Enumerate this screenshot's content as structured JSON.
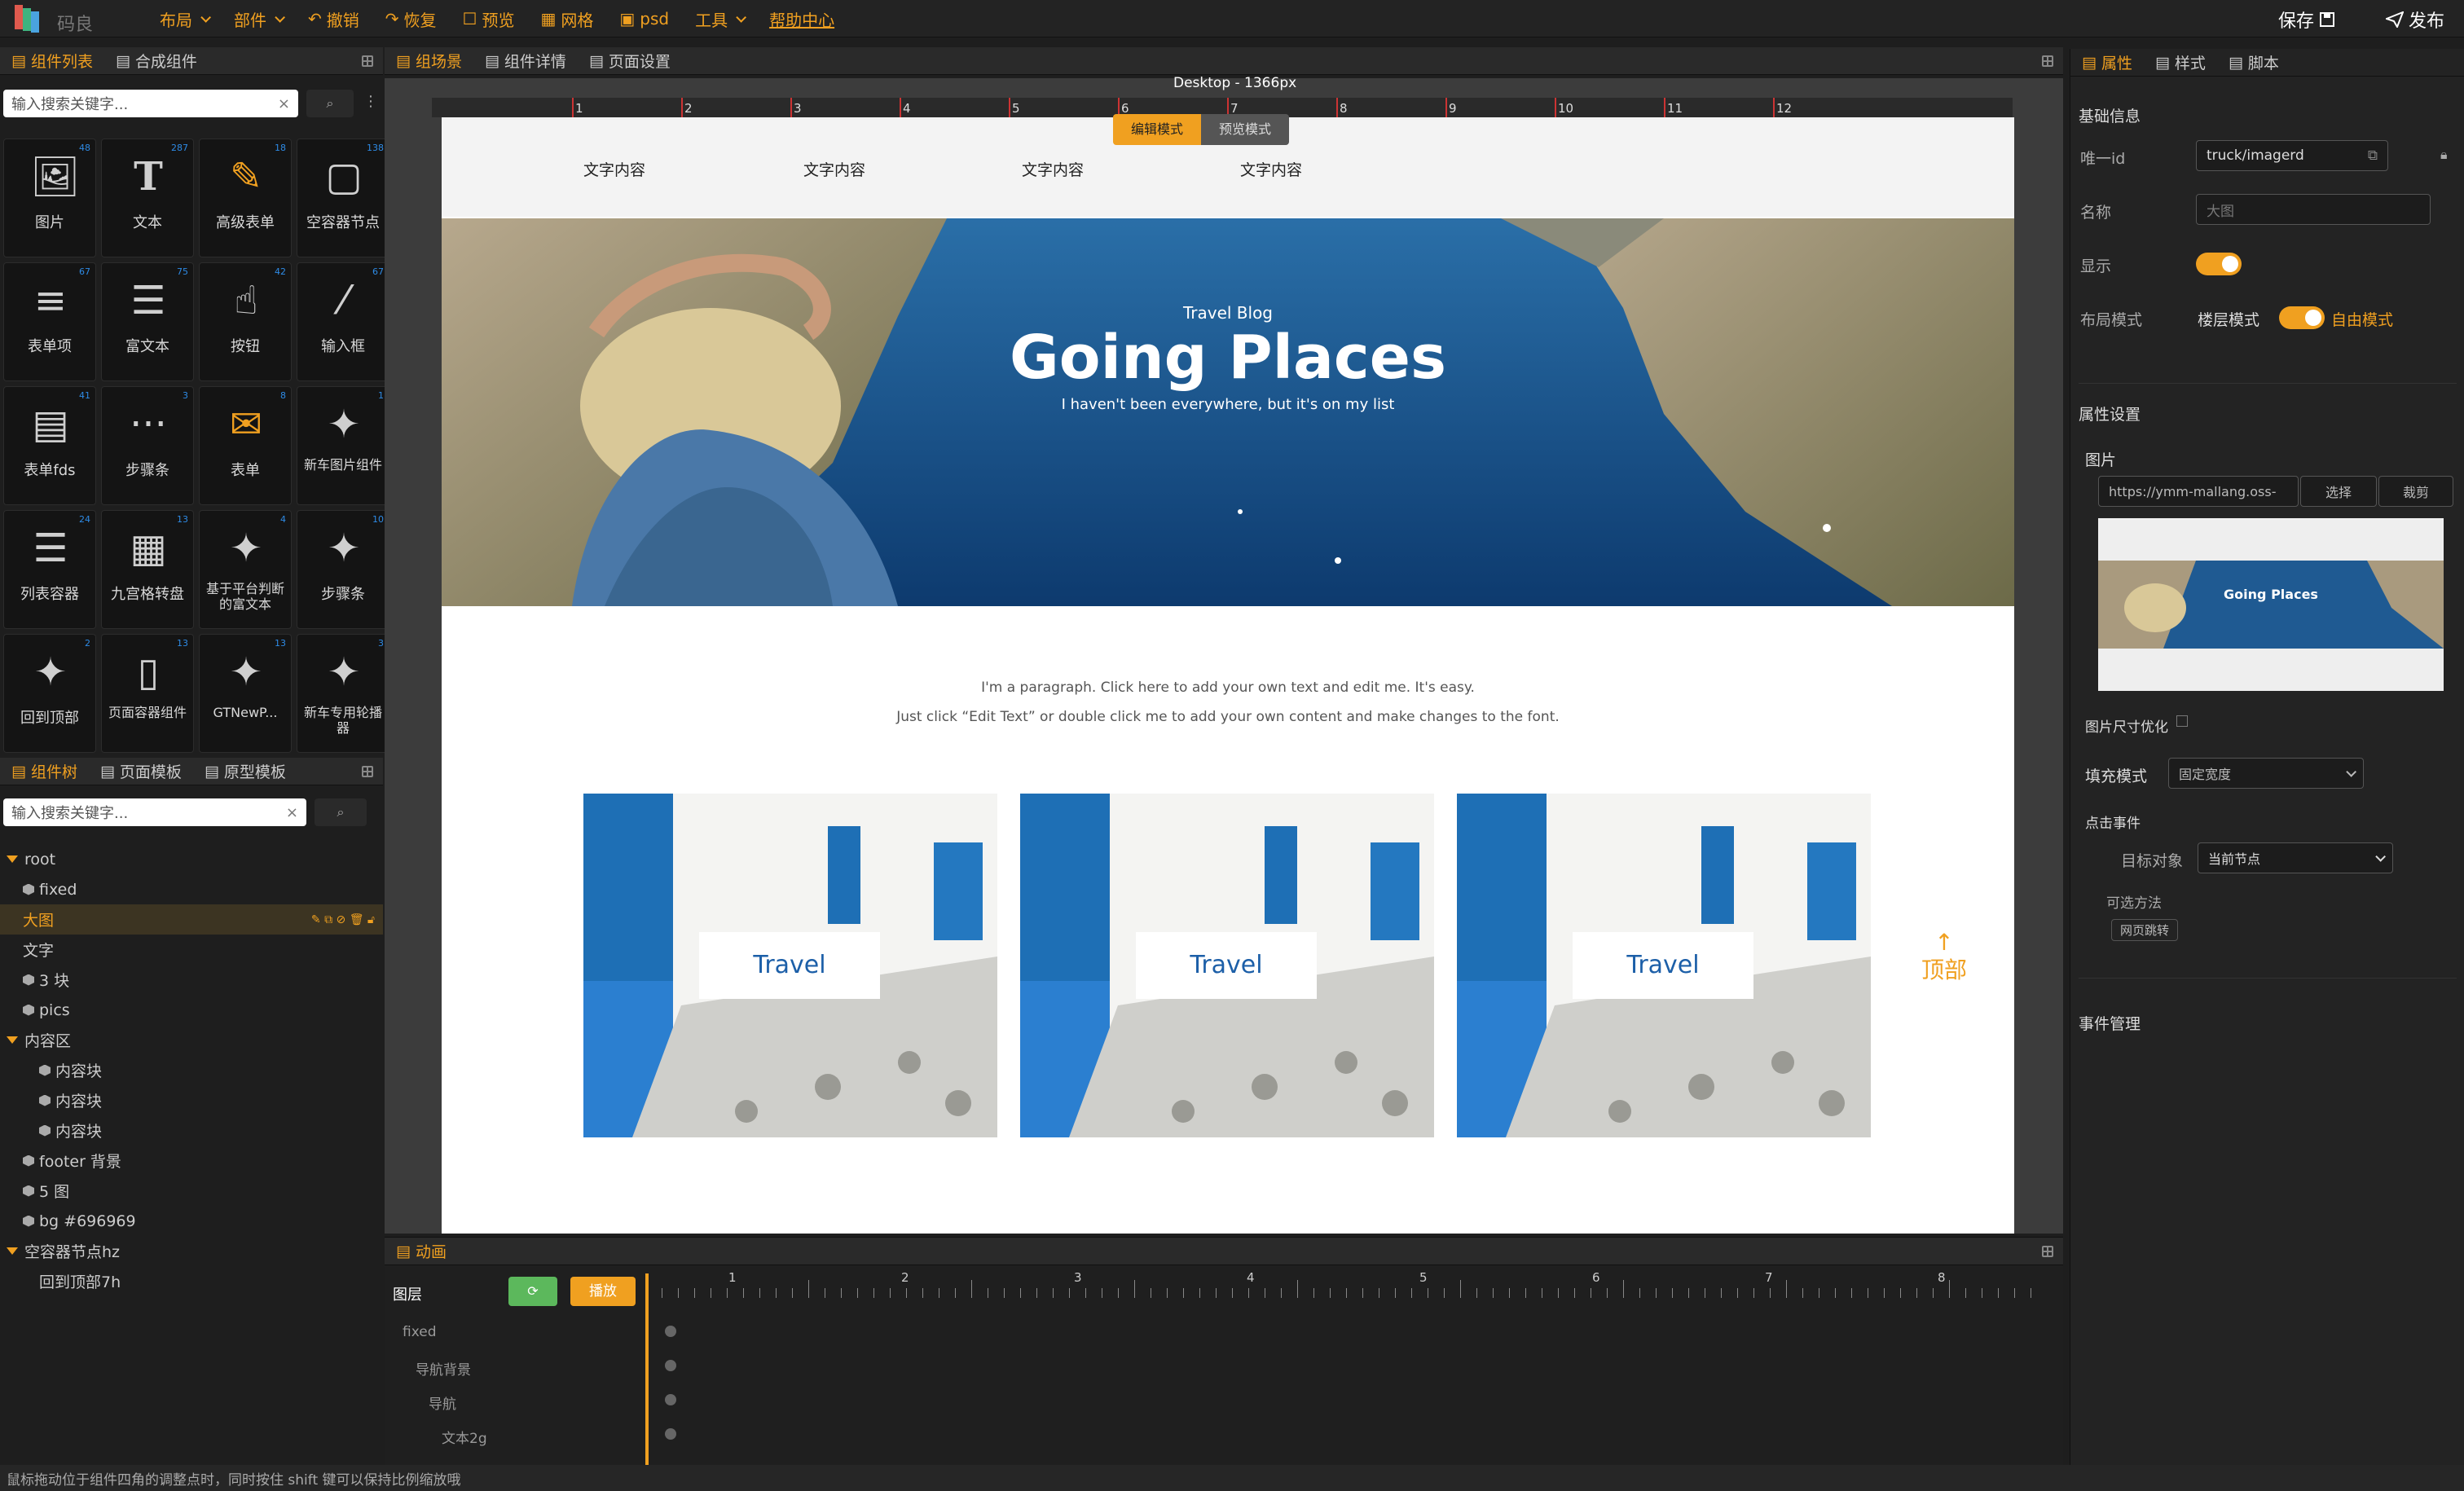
{
  "app": {
    "brand": "码良"
  },
  "menu": [
    {
      "label": "布局",
      "dropdown": true
    },
    {
      "label": "部件",
      "dropdown": true
    },
    {
      "label": "撤销",
      "dropdown": false
    },
    {
      "label": "恢复",
      "dropdown": false
    },
    {
      "label": "预览",
      "dropdown": false
    },
    {
      "label": "网格",
      "dropdown": false
    },
    {
      "label": "psd",
      "dropdown": false
    },
    {
      "label": "工具",
      "dropdown": true
    },
    {
      "label": "帮助中心",
      "dropdown": false
    }
  ],
  "actions": {
    "save": "保存",
    "publish": "发布"
  },
  "leftTop": {
    "tabs": [
      "组件列表",
      "合成组件"
    ],
    "searchPlaceholder": "输入搜索关键字...",
    "components": [
      {
        "label": "图片",
        "badge": "48",
        "icon": "image-icon"
      },
      {
        "label": "文本",
        "badge": "287",
        "icon": "text-icon"
      },
      {
        "label": "高级表单",
        "badge": "18",
        "icon": "advanced-form-icon"
      },
      {
        "label": "空容器节点",
        "badge": "138",
        "icon": "empty-container-icon"
      },
      {
        "label": "表单项",
        "badge": "67",
        "icon": "form-item-icon"
      },
      {
        "label": "富文本",
        "badge": "75",
        "icon": "rich-text-icon"
      },
      {
        "label": "按钮",
        "badge": "42",
        "icon": "button-icon"
      },
      {
        "label": "输入框",
        "badge": "67",
        "icon": "input-icon"
      },
      {
        "label": "表单fds",
        "badge": "41",
        "icon": "form-fds-icon"
      },
      {
        "label": "步骤条",
        "badge": "3",
        "icon": "steps-icon"
      },
      {
        "label": "表单",
        "badge": "8",
        "icon": "form-icon"
      },
      {
        "label": "新车图片组件",
        "badge": "1",
        "icon": "puzzle-icon"
      },
      {
        "label": "列表容器",
        "badge": "24",
        "icon": "list-container-icon"
      },
      {
        "label": "九宫格转盘",
        "badge": "13",
        "icon": "grid-wheel-icon"
      },
      {
        "label": "基于平台判断的富文本",
        "badge": "4",
        "icon": "puzzle-icon"
      },
      {
        "label": "步骤条",
        "badge": "10",
        "icon": "puzzle-icon"
      },
      {
        "label": "回到顶部",
        "badge": "2",
        "icon": "puzzle-icon"
      },
      {
        "label": "页面容器组件",
        "badge": "13",
        "icon": "page-container-icon"
      },
      {
        "label": "GTNewP...",
        "badge": "13",
        "icon": "puzzle-icon"
      },
      {
        "label": "新车专用轮播器",
        "badge": "3",
        "icon": "puzzle-icon"
      }
    ]
  },
  "leftBottom": {
    "tabs": [
      "组件树",
      "页面模板",
      "原型模板"
    ],
    "searchPlaceholder": "输入搜索关键字...",
    "tree": [
      {
        "label": "root",
        "indent": 0,
        "type": "folder-open"
      },
      {
        "label": "fixed",
        "indent": 1,
        "type": "node"
      },
      {
        "label": "大图",
        "indent": 1,
        "type": "selected"
      },
      {
        "label": "文字",
        "indent": 1,
        "type": "plain"
      },
      {
        "label": "3 块",
        "indent": 1,
        "type": "node"
      },
      {
        "label": "pics",
        "indent": 1,
        "type": "node"
      },
      {
        "label": "内容区",
        "indent": 0,
        "type": "folder-open"
      },
      {
        "label": "内容块",
        "indent": 2,
        "type": "node"
      },
      {
        "label": "内容块",
        "indent": 2,
        "type": "node"
      },
      {
        "label": "内容块",
        "indent": 2,
        "type": "node"
      },
      {
        "label": "footer 背景",
        "indent": 1,
        "type": "node"
      },
      {
        "label": "5 图",
        "indent": 1,
        "type": "node"
      },
      {
        "label": "bg #696969",
        "indent": 1,
        "type": "node"
      },
      {
        "label": "空容器节点hz",
        "indent": 0,
        "type": "folder-open"
      },
      {
        "label": "回到顶部7h",
        "indent": 2,
        "type": "plain"
      }
    ]
  },
  "centerTabs": [
    "组场景",
    "组件详情",
    "页面设置"
  ],
  "canvas": {
    "deviceLabel": "Desktop - 1366px",
    "rulerMarks": [
      "1",
      "2",
      "3",
      "4",
      "5",
      "6",
      "7",
      "8",
      "9",
      "10",
      "11",
      "12"
    ],
    "modes": {
      "edit": "编辑模式",
      "preview": "预览模式"
    },
    "navItems": [
      "文字内容",
      "文字内容",
      "文字内容",
      "文字内容"
    ],
    "hero": {
      "kicker": "Travel Blog",
      "title": "Going Places",
      "subtitle": "I haven't been everywhere, but it's on my list"
    },
    "paragraph1": "I'm a paragraph. Click here to add your own text and edit me. It's easy.",
    "paragraph2": "Just click “Edit Text” or double click me to add your own content and make changes to the font.",
    "cards": [
      "Travel",
      "Travel",
      "Travel"
    ],
    "toTop": "顶部"
  },
  "rightPanel": {
    "tabs": [
      "属性",
      "样式",
      "脚本"
    ],
    "basicInfo": "基础信息",
    "uidLabel": "唯一id",
    "uidValue": "truck/imagerd",
    "nameLabel": "名称",
    "namePlaceholder": "大图",
    "showLabel": "显示",
    "layoutLabel": "布局模式",
    "floorMode": "楼层模式",
    "freeMode": "自由模式",
    "propSettings": "属性设置",
    "imageLabel": "图片",
    "imageUrl": "https://ymm-mallang.oss-",
    "selectBtn": "选择",
    "cropBtn": "裁剪",
    "previewTitle": "Going Places",
    "sizeOpt": "图片尺寸优化",
    "fillLabel": "填充模式",
    "fillValue": "固定宽度",
    "clickEvent": "点击事件",
    "targetLabel": "目标对象",
    "targetValue": "当前节点",
    "methodLabel": "可选方法",
    "methodTag": "网页跳转",
    "eventMgmt": "事件管理"
  },
  "animation": {
    "title": "动画",
    "layerHeader": "图层",
    "play": "播放",
    "timeline": [
      "1",
      "2",
      "3",
      "4",
      "5",
      "6",
      "7",
      "8"
    ],
    "layers": [
      {
        "label": "fixed",
        "indent": 0
      },
      {
        "label": "导航背景",
        "indent": 1
      },
      {
        "label": "导航",
        "indent": 2
      },
      {
        "label": "文本2g",
        "indent": 3
      }
    ]
  },
  "status": "鼠标拖动位于组件四角的调整点时，同时按住 shift 键可以保持比例缩放哦",
  "colors": {
    "accent": "#f0a020",
    "panel": "#232323",
    "link": "#1c5fa8",
    "playGreen": "#5cb85c"
  }
}
